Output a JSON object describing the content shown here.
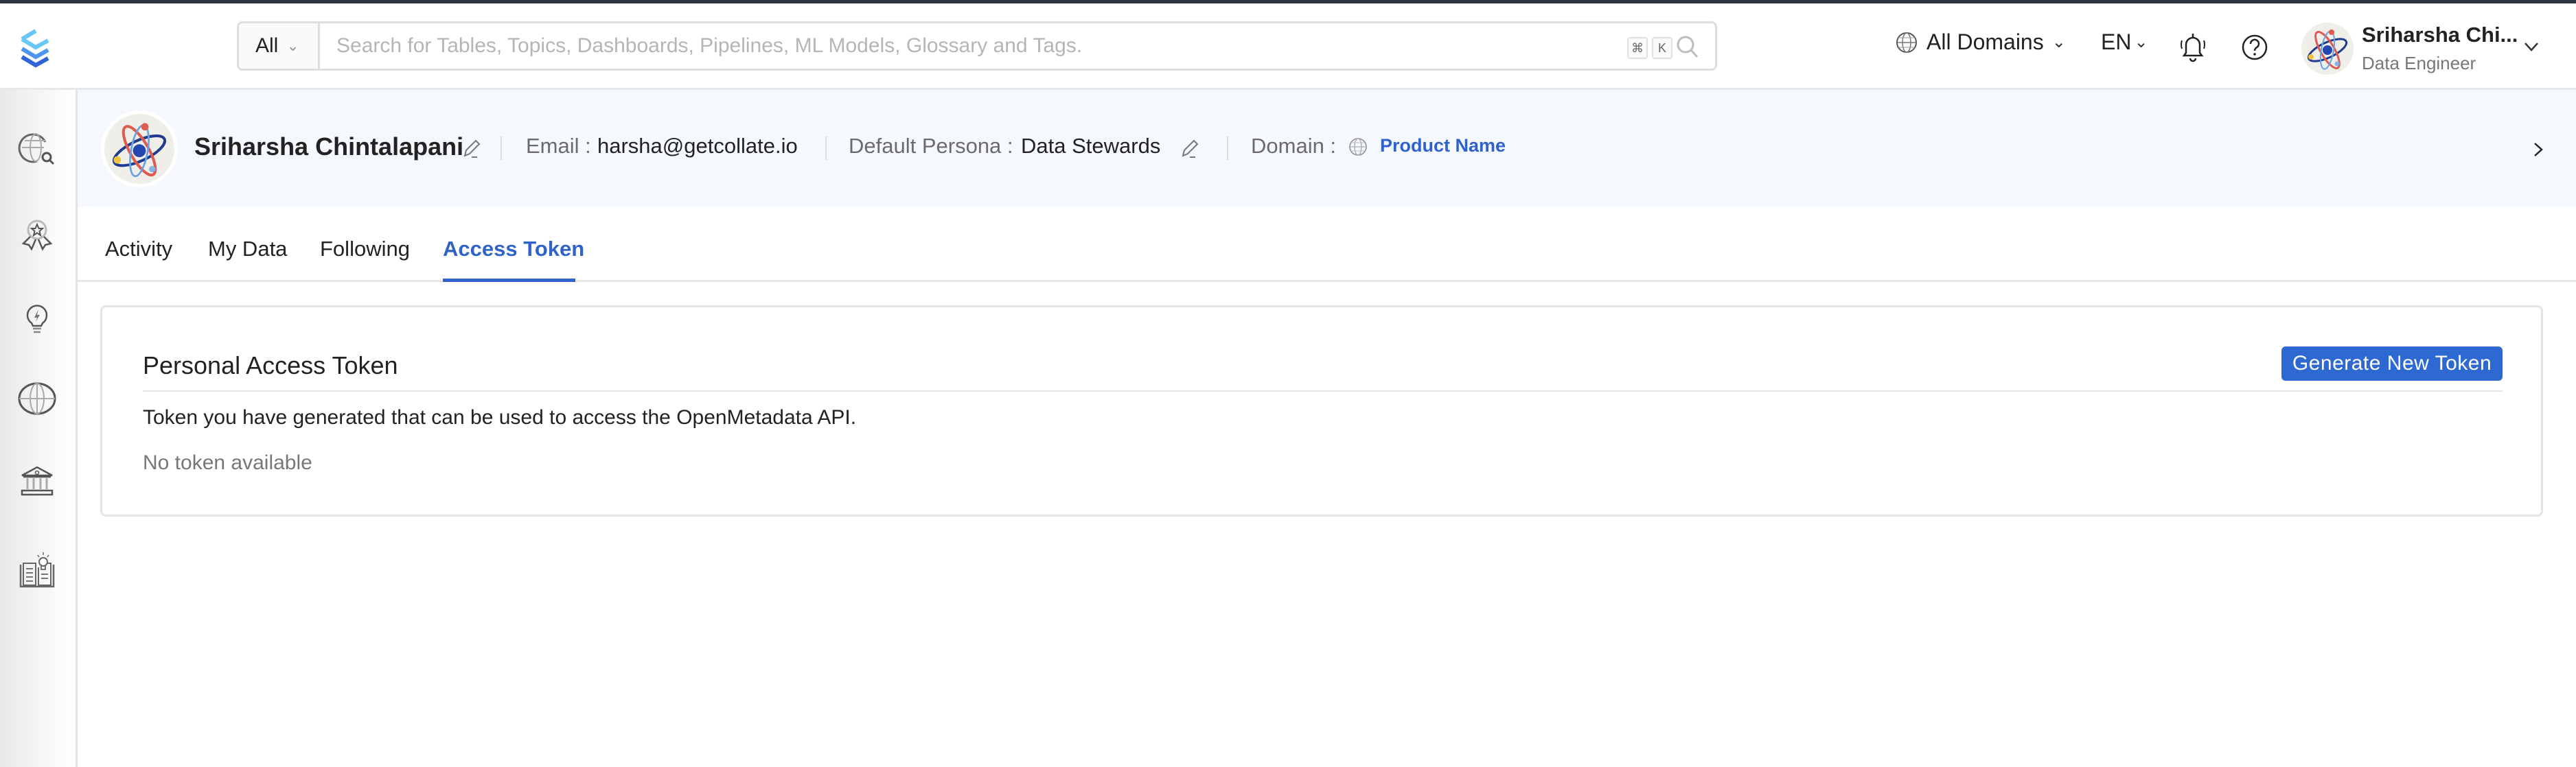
{
  "header": {
    "search_scope": "All",
    "search_placeholder": "Search for Tables, Topics, Dashboards, Pipelines, ML Models, Glossary and Tags.",
    "shortcut_keys": [
      "⌘",
      "K"
    ],
    "domain_selector": "All Domains",
    "language": "EN",
    "user": {
      "name": "Sriharsha Chi...",
      "role": "Data Engineer"
    }
  },
  "sidebar": {
    "items": [
      {
        "icon": "explore-icon"
      },
      {
        "icon": "quality-badge-icon"
      },
      {
        "icon": "insights-bulb-icon"
      },
      {
        "icon": "domains-globe-icon"
      },
      {
        "icon": "governance-building-icon"
      },
      {
        "icon": "knowledge-book-icon"
      }
    ]
  },
  "profile": {
    "name": "Sriharsha Chintalapani",
    "email_label": "Email :",
    "email": "harsha@getcollate.io",
    "persona_label": "Default Persona :",
    "persona": "Data Stewards",
    "domain_label": "Domain :",
    "domain": "Product Name"
  },
  "tabs": [
    {
      "label": "Activity",
      "active": false
    },
    {
      "label": "My Data",
      "active": false
    },
    {
      "label": "Following",
      "active": false
    },
    {
      "label": "Access Token",
      "active": true
    }
  ],
  "token_card": {
    "title": "Personal Access Token",
    "generate_button": "Generate New Token",
    "description": "Token you have generated that can be used to access the OpenMetadata API.",
    "empty_text": "No token available"
  },
  "colors": {
    "accent": "#2f63c9",
    "button": "#2e68d1",
    "profile_band": "#f5f8fd"
  }
}
